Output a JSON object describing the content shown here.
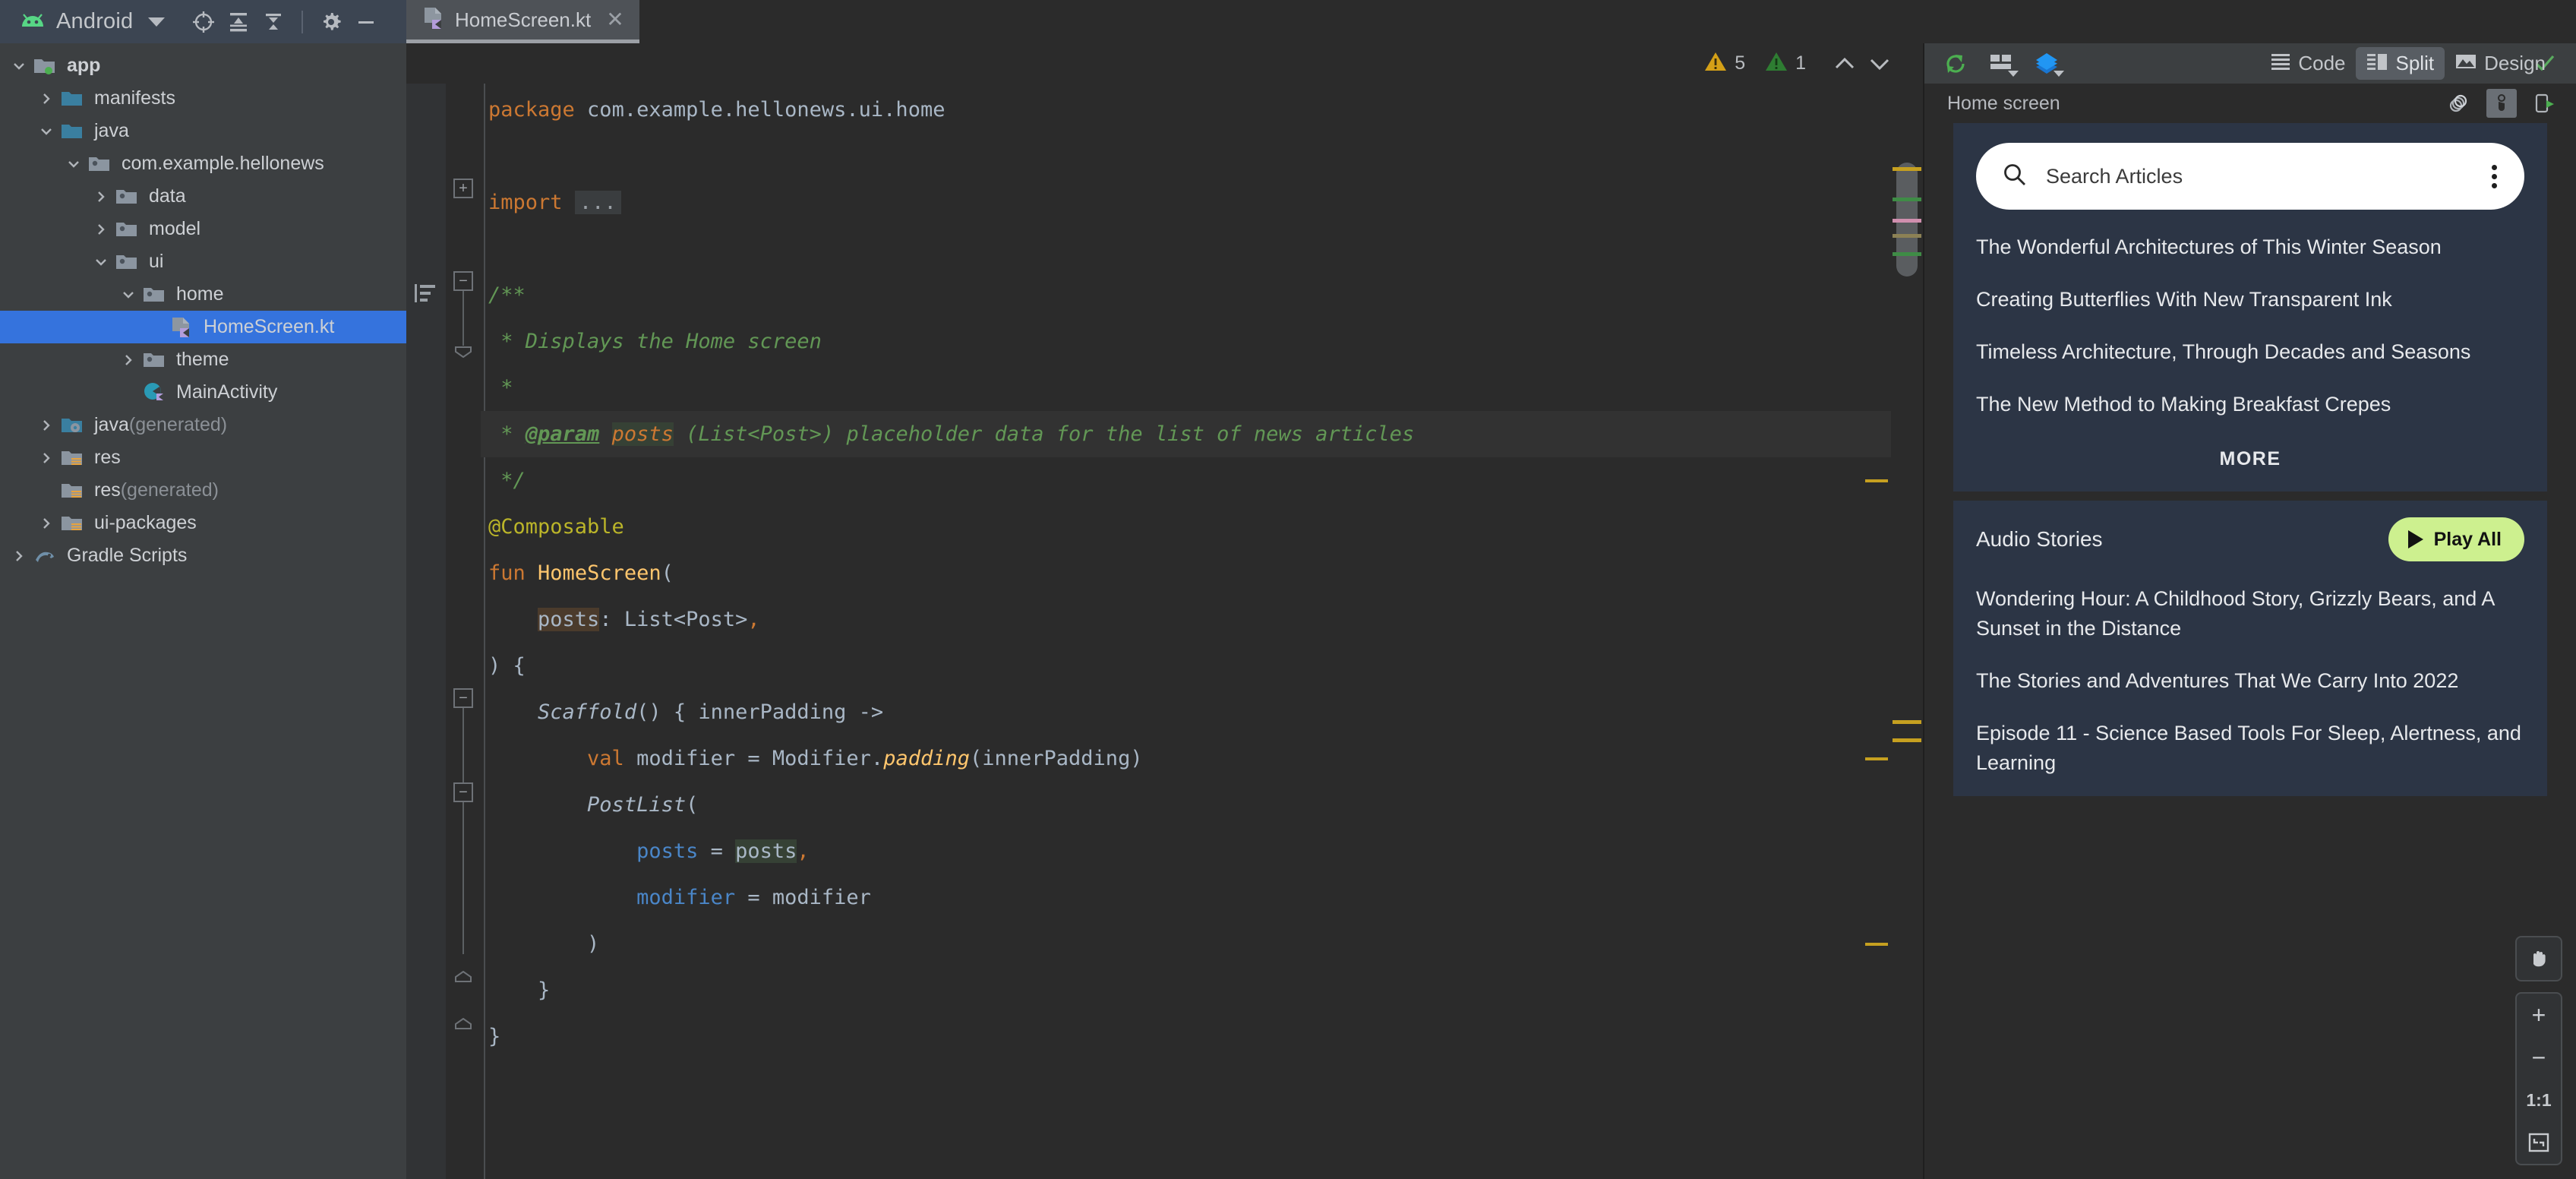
{
  "project_toolbar": {
    "app_name": "Android",
    "logo_icon": "android-robot-icon",
    "dropdown_icon": "chevron-down-icon",
    "icons": [
      "target-locate-icon",
      "expand-all-icon",
      "collapse-all-icon",
      "gear-icon",
      "minimize-icon"
    ]
  },
  "tabs": [
    {
      "label": "HomeScreen.kt",
      "icon": "kotlin-file-icon",
      "close_icon": "close-icon",
      "active": true
    }
  ],
  "view_modes": {
    "items": [
      {
        "label": "Code",
        "icon": "code-lines-icon",
        "active": false
      },
      {
        "label": "Split",
        "icon": "split-view-icon",
        "active": true
      },
      {
        "label": "Design",
        "icon": "design-image-icon",
        "active": false
      }
    ]
  },
  "project_tree": [
    {
      "label": "app",
      "icon": "module-folder-icon",
      "arrow": "expanded",
      "indent": 0,
      "bold": true,
      "selected": false
    },
    {
      "label": "manifests",
      "icon": "folder-blue-icon",
      "arrow": "collapsed",
      "indent": 1,
      "bold": false,
      "selected": false
    },
    {
      "label": "java",
      "icon": "folder-blue-icon",
      "arrow": "expanded",
      "indent": 1,
      "bold": false,
      "selected": false
    },
    {
      "label": "com.example.hellonews",
      "icon": "package-folder-icon",
      "arrow": "expanded",
      "indent": 2,
      "bold": false,
      "selected": false
    },
    {
      "label": "data",
      "icon": "package-folder-icon",
      "arrow": "collapsed",
      "indent": 3,
      "bold": false,
      "selected": false
    },
    {
      "label": "model",
      "icon": "package-folder-icon",
      "arrow": "collapsed",
      "indent": 3,
      "bold": false,
      "selected": false
    },
    {
      "label": "ui",
      "icon": "package-folder-icon",
      "arrow": "expanded",
      "indent": 3,
      "bold": false,
      "selected": false
    },
    {
      "label": "home",
      "icon": "package-folder-icon",
      "arrow": "expanded",
      "indent": 4,
      "bold": false,
      "selected": false
    },
    {
      "label": "HomeScreen.kt",
      "icon": "kotlin-file-icon",
      "arrow": "none",
      "indent": 5,
      "bold": false,
      "selected": true
    },
    {
      "label": "theme",
      "icon": "package-folder-icon",
      "arrow": "collapsed",
      "indent": 4,
      "bold": false,
      "selected": false
    },
    {
      "label": "MainActivity",
      "icon": "kotlin-class-icon",
      "arrow": "none",
      "indent": 4,
      "bold": false,
      "selected": false
    },
    {
      "label": "java",
      "suffix": " (generated)",
      "icon": "folder-generated-icon",
      "arrow": "collapsed",
      "indent": 1,
      "bold": false,
      "selected": false
    },
    {
      "label": "res",
      "icon": "folder-res-icon",
      "arrow": "collapsed",
      "indent": 1,
      "bold": false,
      "selected": false
    },
    {
      "label": "res",
      "suffix": " (generated)",
      "icon": "folder-res-icon",
      "arrow": "none",
      "indent": 1,
      "bold": false,
      "selected": false
    },
    {
      "label": "ui-packages",
      "icon": "folder-res-icon",
      "arrow": "collapsed",
      "indent": 1,
      "bold": false,
      "selected": false
    },
    {
      "label": "Gradle Scripts",
      "icon": "gradle-icon",
      "arrow": "collapsed",
      "indent": 0,
      "bold": false,
      "selected": false
    }
  ],
  "editor_status": {
    "warning_count": "5",
    "weak_warning_count": "1",
    "warning_icon": "warning-triangle-yellow-icon",
    "weak_warning_icon": "warning-triangle-green-icon",
    "prev_icon": "chevron-up-icon",
    "next_icon": "chevron-down-icon"
  },
  "code": {
    "language": "kotlin",
    "lines": [
      "package com.example.hellonews.ui.home",
      "",
      "import ...",
      "",
      "/**",
      " * Displays the Home screen",
      " *",
      " * @param posts (List<Post>) placeholder data for the list of news articles",
      " */",
      "@Composable",
      "fun HomeScreen(",
      "    posts: List<Post>,",
      ") {",
      "    Scaffold() { innerPadding ->",
      "        val modifier = Modifier.padding(innerPadding)",
      "        PostList(",
      "            posts = posts,",
      "            modifier = modifier",
      "        )",
      "    }",
      "}"
    ]
  },
  "preview": {
    "toolbar_icons": [
      "refresh-green-icon",
      "layout-grid-icon",
      "layers-blue-icon"
    ],
    "status_icon": "checkmark-green-icon",
    "title": "Home screen",
    "header_icons": [
      "multi-preview-icon",
      "interactive-mode-icon",
      "run-on-device-icon"
    ],
    "device": {
      "search": {
        "placeholder": "Search Articles",
        "search_icon": "search-icon",
        "menu_icon": "kebab-menu-icon"
      },
      "articles": [
        "The Wonderful Architectures of This Winter Season",
        "Creating Butterflies With New Transparent Ink",
        "Timeless Architecture, Through Decades and Seasons",
        "The New Method to Making Breakfast Crepes"
      ],
      "more_label": "MORE",
      "audio": {
        "title": "Audio Stories",
        "play_all_label": "Play All",
        "play_icon": "play-triangle-icon",
        "stories": [
          "Wondering Hour: A Childhood Story, Grizzly Bears, and A Sunset in the Distance",
          "The Stories and Adventures That We Carry Into 2022",
          "Episode 11 - Science Based Tools For Sleep, Alertness, and Learning"
        ]
      }
    },
    "zoom_controls": {
      "pan_icon": "hand-pan-icon",
      "zoom_in_label": "+",
      "zoom_out_label": "−",
      "actual_size_label": "1:1",
      "fit_icon": "fit-to-screen-icon"
    }
  },
  "colors": {
    "selection_blue": "#3573dd",
    "accent_green": "#cdf08f",
    "phone_card_bg": "#2c3545",
    "keyword_orange": "#cc7832",
    "comment_green": "#629755",
    "annotation_yellow": "#bbb529"
  }
}
